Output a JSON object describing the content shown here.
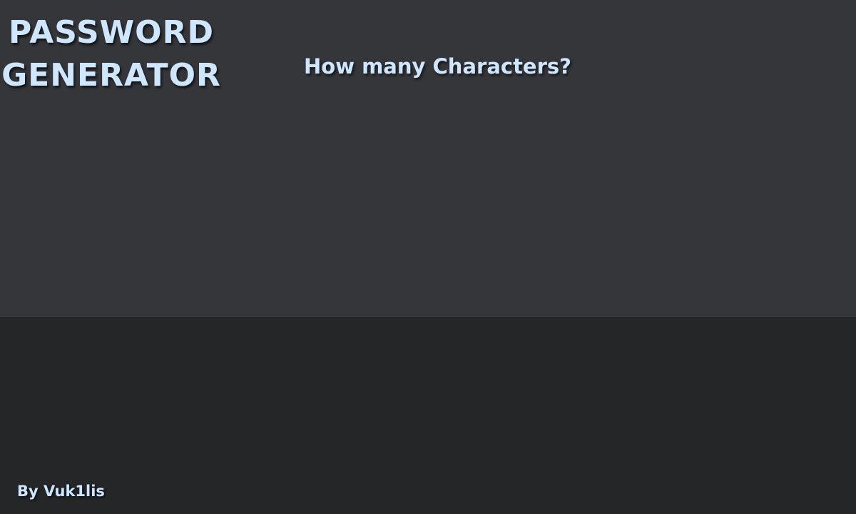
{
  "app": {
    "title_line1": "PASSWORD",
    "title_line2": "GENERATOR"
  },
  "main": {
    "question": "How many Characters?"
  },
  "footer": {
    "author": "By Vuk1lis"
  },
  "colors": {
    "top_panel": "#35363a",
    "bottom_panel": "#252628",
    "text": "#cfe6ff"
  }
}
